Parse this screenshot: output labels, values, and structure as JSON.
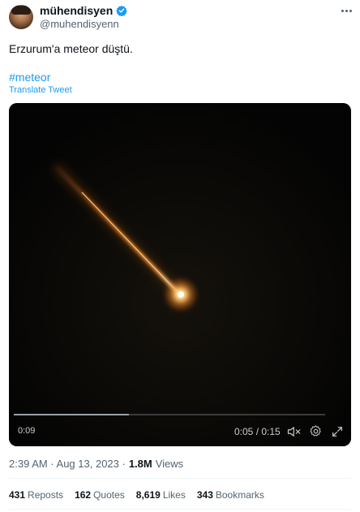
{
  "author": {
    "display_name": "mühendisyen",
    "handle": "@muhendisyenn",
    "verified": true
  },
  "tweet": {
    "text": "Erzurum'a meteor düştü.",
    "hashtag": "#meteor",
    "translate_label": "Translate Tweet"
  },
  "video": {
    "remaining": "0:09",
    "time_readout": "0:05 / 0:15",
    "progress": 0.37
  },
  "meta": {
    "timestamp": "2:39 AM · Aug 13, 2023 ·",
    "views_count": "1.8M",
    "views_label": "Views"
  },
  "stats": [
    {
      "count": "431",
      "label": "Reposts"
    },
    {
      "count": "162",
      "label": "Quotes"
    },
    {
      "count": "8,619",
      "label": "Likes"
    },
    {
      "count": "343",
      "label": "Bookmarks"
    }
  ],
  "colors": {
    "accent": "#1d9bf0",
    "secondary_text": "#536471",
    "meteor_glow": "#ffb347"
  }
}
